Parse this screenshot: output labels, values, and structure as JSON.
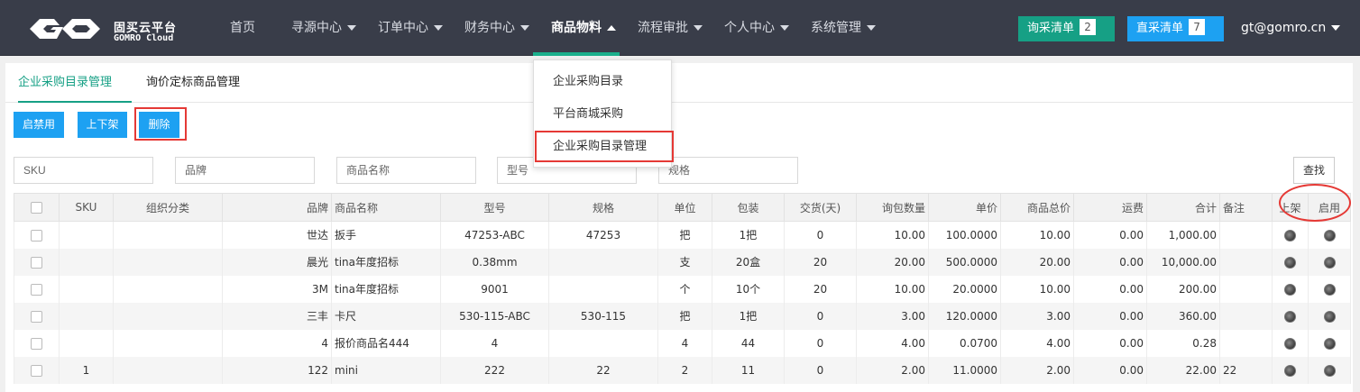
{
  "brand": {
    "name_cn": "固买云平台",
    "name_en": "GOMRO Cloud"
  },
  "nav": {
    "items": [
      {
        "label": "首页",
        "has_caret": false
      },
      {
        "label": "寻源中心",
        "has_caret": true
      },
      {
        "label": "订单中心",
        "has_caret": true
      },
      {
        "label": "财务中心",
        "has_caret": true
      },
      {
        "label": "商品物料",
        "has_caret": true,
        "active": true
      },
      {
        "label": "流程审批",
        "has_caret": true
      },
      {
        "label": "个人中心",
        "has_caret": true
      },
      {
        "label": "系统管理",
        "has_caret": true
      }
    ],
    "dropdown": [
      {
        "label": "企业采购目录"
      },
      {
        "label": "平台商城采购"
      },
      {
        "label": "企业采购目录管理",
        "highlighted": true
      }
    ]
  },
  "header_buttons": {
    "inquiry": {
      "label": "询采清单",
      "count": "2",
      "color": "#16a085"
    },
    "direct": {
      "label": "直采清单",
      "count": "7",
      "color": "#1da1f2"
    }
  },
  "user": {
    "email": "gt@gomro.cn"
  },
  "tabs": [
    {
      "label": "企业采购目录管理",
      "active": true
    },
    {
      "label": "询价定标商品管理",
      "active": false
    }
  ],
  "actions": {
    "enable_disable": "启禁用",
    "shelve": "上下架",
    "delete": "删除"
  },
  "filters": {
    "sku": "SKU",
    "brand": "品牌",
    "product_name": "商品名称",
    "model": "型号",
    "spec": "规格",
    "find": "查找"
  },
  "table": {
    "columns": [
      "SKU",
      "组织分类",
      "品牌",
      "商品名称",
      "型号",
      "规格",
      "单位",
      "包装",
      "交货(天)",
      "询包数量",
      "单价",
      "商品总价",
      "运费",
      "合计",
      "备注",
      "上架",
      "启用"
    ],
    "rows": [
      {
        "sku": "",
        "org": "",
        "brand": "世达",
        "name": "扳手",
        "model": "47253-ABC",
        "spec": "47253",
        "unit": "把",
        "pack": "1把",
        "days": "0",
        "qty": "10.00",
        "price": "100.0000",
        "goods_total": "10.00",
        "freight": "0.00",
        "total": "1,000.00",
        "remark": ""
      },
      {
        "sku": "",
        "org": "",
        "brand": "晨光",
        "name": "tina年度招标",
        "model": "0.38mm",
        "spec": "",
        "unit": "支",
        "pack": "20盒",
        "days": "20",
        "qty": "20.00",
        "price": "500.0000",
        "goods_total": "20.00",
        "freight": "0.00",
        "total": "10,000.00",
        "remark": ""
      },
      {
        "sku": "",
        "org": "",
        "brand": "3M",
        "name": "tina年度招标",
        "model": "9001",
        "spec": "",
        "unit": "个",
        "pack": "10个",
        "days": "20",
        "qty": "10.00",
        "price": "20.0000",
        "goods_total": "10.00",
        "freight": "0.00",
        "total": "200.00",
        "remark": ""
      },
      {
        "sku": "",
        "org": "",
        "brand": "三丰",
        "name": "卡尺",
        "model": "530-115-ABC",
        "spec": "530-115",
        "unit": "把",
        "pack": "1把",
        "days": "0",
        "qty": "3.00",
        "price": "120.0000",
        "goods_total": "3.00",
        "freight": "0.00",
        "total": "360.00",
        "remark": ""
      },
      {
        "sku": "",
        "org": "",
        "brand": "4",
        "name": "报价商品名444",
        "model": "4",
        "spec": "",
        "unit": "4",
        "pack": "44",
        "days": "0",
        "qty": "4.00",
        "price": "0.0700",
        "goods_total": "4.00",
        "freight": "0.00",
        "total": "0.28",
        "remark": ""
      },
      {
        "sku": "1",
        "org": "",
        "brand": "122",
        "name": "mini",
        "model": "222",
        "spec": "22",
        "unit": "2",
        "pack": "11",
        "days": "0",
        "qty": "2.00",
        "price": "11.0000",
        "goods_total": "2.00",
        "freight": "0.00",
        "total": "22.00",
        "remark": "22"
      }
    ]
  }
}
